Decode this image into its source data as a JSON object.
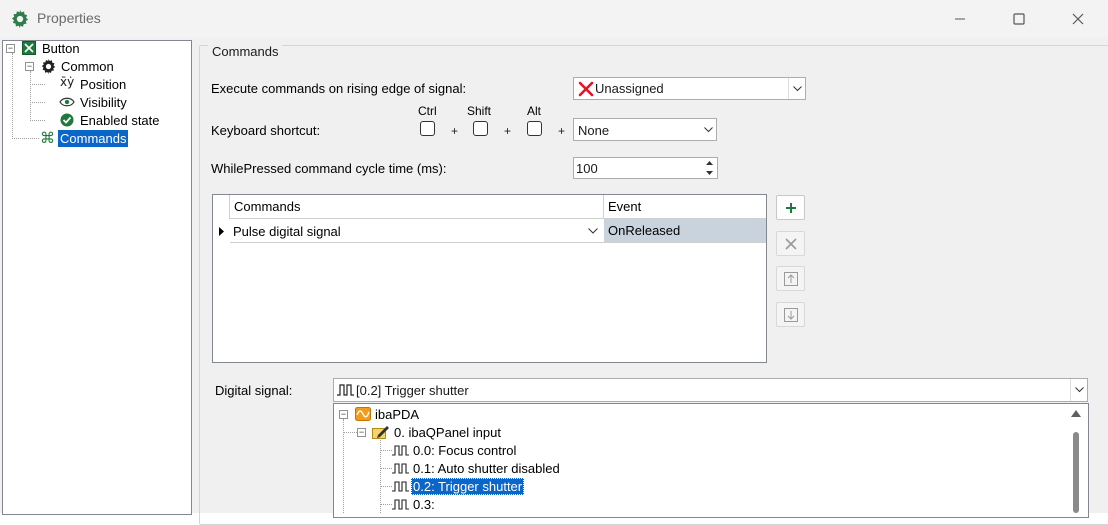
{
  "window": {
    "title": "Properties",
    "minimize_icon": "minimize-icon",
    "maximize_icon": "maximize-icon",
    "close_icon": "close-icon"
  },
  "tree": {
    "root": {
      "label": "Button",
      "icon": "button-icon"
    },
    "common": {
      "label": "Common",
      "icon": "gear-icon"
    },
    "items": [
      {
        "label": "Position",
        "icon": "xy-icon"
      },
      {
        "label": "Visibility",
        "icon": "eye-icon"
      },
      {
        "label": "Enabled state",
        "icon": "check-circle-icon"
      }
    ],
    "commands": {
      "label": "Commands",
      "icon": "command-icon"
    }
  },
  "panel": {
    "title": "Commands",
    "rising_edge_label": "Execute commands on rising edge of signal:",
    "rising_edge_value": "Unassigned",
    "keyboard_label": "Keyboard shortcut:",
    "ctrl_label": "Ctrl",
    "shift_label": "Shift",
    "alt_label": "Alt",
    "plus": "+",
    "key_value": "None",
    "cycle_label": "WhilePressed command cycle time (ms):",
    "cycle_value": "100"
  },
  "grid": {
    "headers": [
      "Commands",
      "Event"
    ],
    "rows": [
      {
        "command": "Pulse digital signal",
        "event": "OnReleased"
      }
    ]
  },
  "side_buttons": [
    "add-icon",
    "delete-icon",
    "move-up-icon",
    "move-down-icon"
  ],
  "digital": {
    "label": "Digital signal:",
    "value": "[0.2] Trigger shutter",
    "tree": {
      "root": "ibaPDA",
      "group": "0. ibaQPanel input",
      "signals": [
        "0.0: Focus control",
        "0.1: Auto shutter disabled",
        "0.2: Trigger shutter",
        "0.3:"
      ]
    }
  },
  "colors": {
    "accent": "#0a66c8",
    "event_cell": "#c9d3de",
    "green": "#1e7a3c",
    "red": "#e81123"
  }
}
